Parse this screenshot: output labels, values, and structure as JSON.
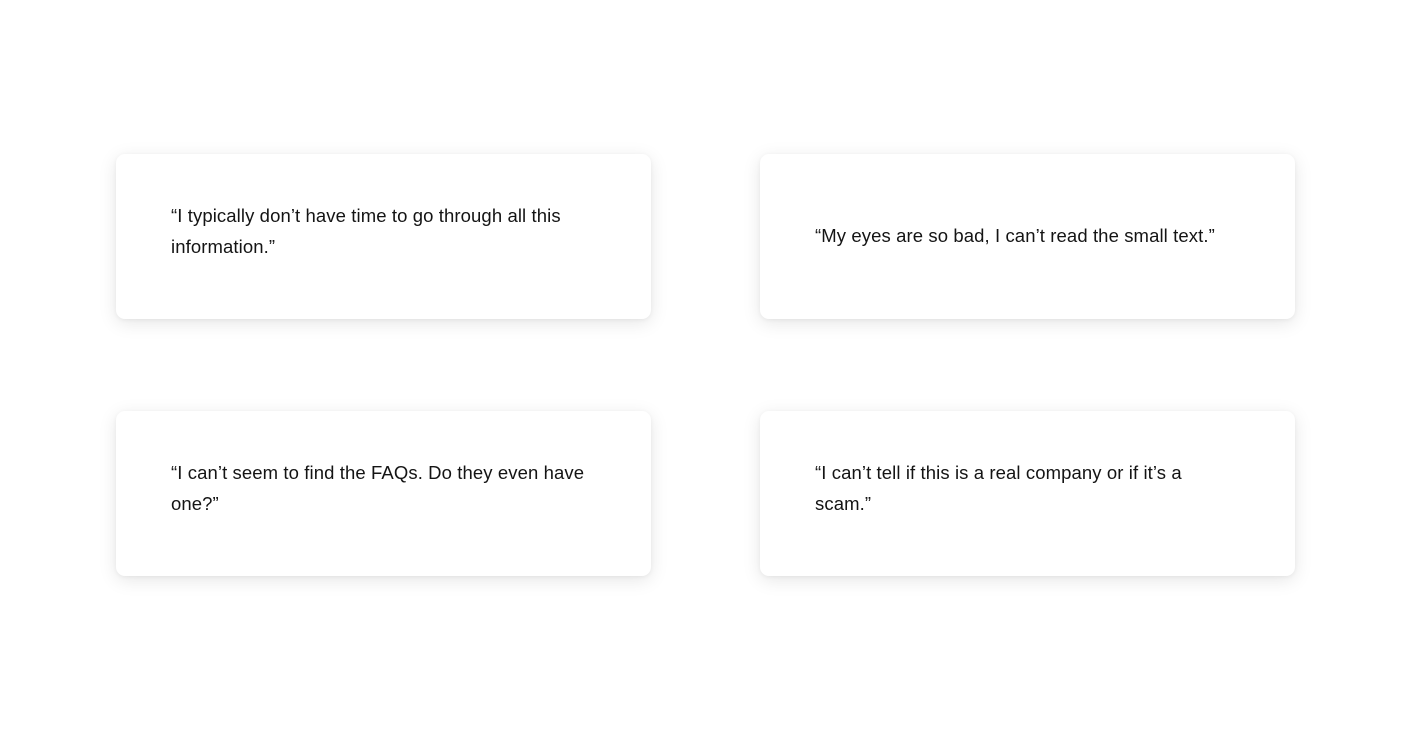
{
  "quotes": [
    {
      "text": "“I typically don’t have time to go through all this information.”"
    },
    {
      "text": "“My eyes are so bad, I can’t read the small text.”"
    },
    {
      "text": "“I can’t seem to find the FAQs. Do they even have one?”"
    },
    {
      "text": "“I can’t tell if this is a real company or if it’s a scam.”"
    }
  ]
}
